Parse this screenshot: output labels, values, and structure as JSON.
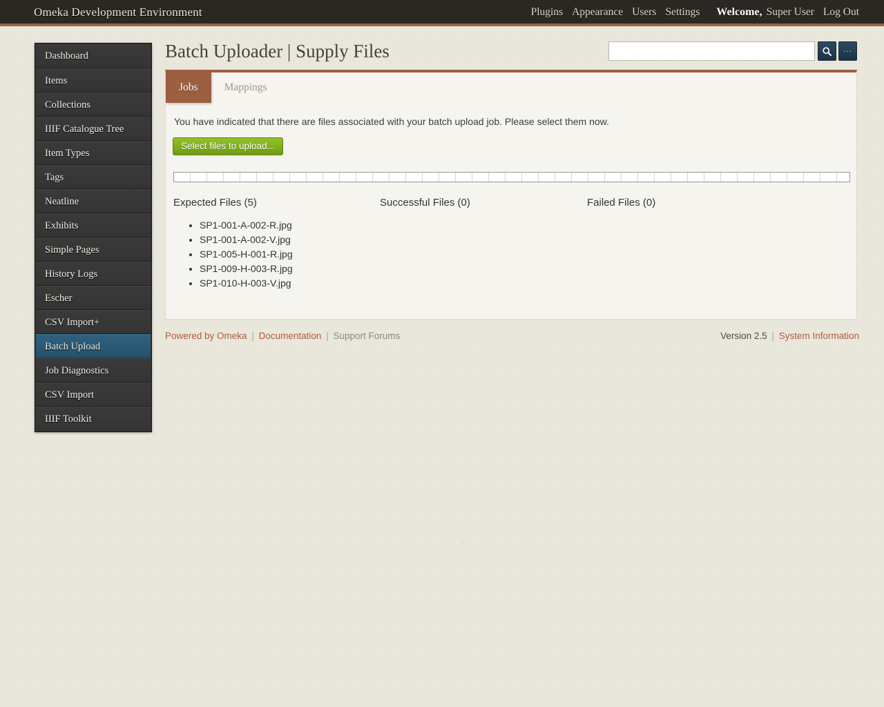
{
  "header": {
    "site_title": "Omeka Development Environment",
    "nav": [
      {
        "label": "Plugins"
      },
      {
        "label": "Appearance"
      },
      {
        "label": "Users"
      },
      {
        "label": "Settings"
      }
    ],
    "welcome_word": "Welcome,",
    "user_name": "Super User",
    "logout_label": "Log Out"
  },
  "sidebar": {
    "items": [
      {
        "label": "Dashboard",
        "current": false
      },
      {
        "label": "Items",
        "current": false
      },
      {
        "label": "Collections",
        "current": false
      },
      {
        "label": "IIIF Catalogue Tree",
        "current": false
      },
      {
        "label": "Item Types",
        "current": false
      },
      {
        "label": "Tags",
        "current": false
      },
      {
        "label": "Neatline",
        "current": false
      },
      {
        "label": "Exhibits",
        "current": false
      },
      {
        "label": "Simple Pages",
        "current": false
      },
      {
        "label": "History Logs",
        "current": false
      },
      {
        "label": "Escher",
        "current": false
      },
      {
        "label": "CSV Import+",
        "current": false
      },
      {
        "label": "Batch Upload",
        "current": true
      },
      {
        "label": "Job Diagnostics",
        "current": false
      },
      {
        "label": "CSV Import",
        "current": false
      },
      {
        "label": "IIIF Toolkit",
        "current": false
      }
    ]
  },
  "main": {
    "page_title": "Batch Uploader | Supply Files",
    "search": {
      "value": "",
      "placeholder": "",
      "search_icon": "search-icon",
      "advanced_label": "..."
    },
    "tabs": [
      {
        "label": "Jobs",
        "active": true
      },
      {
        "label": "Mappings",
        "active": false
      }
    ],
    "instruction": "You have indicated that there are files associated with your batch upload job. Please select them now.",
    "upload_button_label": "Select files to upload...",
    "progress_percent": 0,
    "columns": [
      {
        "heading": "Expected Files (5)",
        "files": [
          "SP1-001-A-002-R.jpg",
          "SP1-001-A-002-V.jpg",
          "SP1-005-H-001-R.jpg",
          "SP1-009-H-003-R.jpg",
          "SP1-010-H-003-V.jpg"
        ]
      },
      {
        "heading": "Successful Files (0)",
        "files": []
      },
      {
        "heading": "Failed Files (0)",
        "files": []
      }
    ]
  },
  "footer": {
    "powered_by": "Powered by Omeka",
    "documentation": "Documentation",
    "support_forums": "Support Forums",
    "separator": "|",
    "version": "Version 2.5",
    "system_information": "System Information"
  },
  "colors": {
    "accent_brown": "#9c5f40",
    "sidebar_active": "#2b5a74",
    "button_green": "#7da71d",
    "link_red": "#b05a3c",
    "page_bg": "#e9e7dc",
    "header_bg": "#2b2722"
  }
}
